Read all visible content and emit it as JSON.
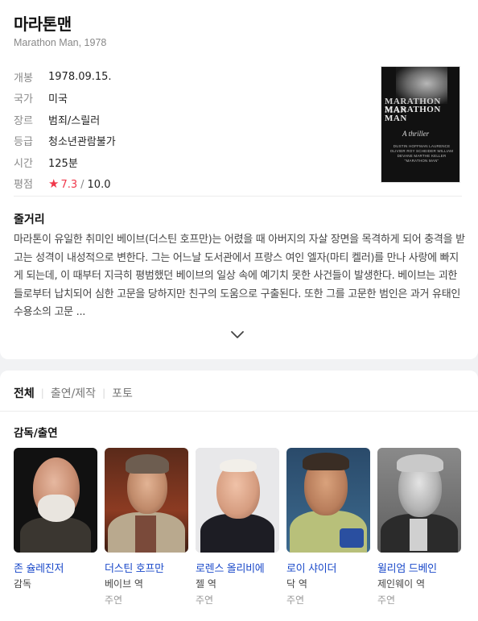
{
  "movie": {
    "title": "마라톤맨",
    "subtitle": "Marathon Man, 1978"
  },
  "facts": [
    {
      "label": "개봉",
      "value": "1978.09.15."
    },
    {
      "label": "국가",
      "value": "미국"
    },
    {
      "label": "장르",
      "value": "범죄/스릴러"
    },
    {
      "label": "등급",
      "value": "청소년관람불가"
    },
    {
      "label": "시간",
      "value": "125분"
    }
  ],
  "rating": {
    "label": "평점",
    "star": "★",
    "score": "7.3",
    "separator": "/",
    "max": "10.0"
  },
  "poster": {
    "title_line1": "MARATHON MAN",
    "title_line2": "MARATHON MAN",
    "tagline": "A thriller",
    "credits": "DUSTIN HOFFMAN LAURENCE OLIVIER ROY SCHEIDER WILLIAM DEVANE MARTHE KELLER \"MARATHON MAN\""
  },
  "synopsis": {
    "title": "줄거리",
    "text": "마라톤이 유일한 취미인 베이브(더스틴 호프만)는 어렸을 때 아버지의 자살 장면을 목격하게 되어 충격을 받고는 성격이 내성적으로 변한다. 그는 어느날 도서관에서 프랑스 여인 엘자(마티 켈러)를 만나 사랑에 빠지게 되는데, 이 때부터 지극히 평범했던 베이브의 일상 속에 예기치 못한 사건들이 발생한다. 베이브는 괴한들로부터 납치되어 심한 고문을 당하지만 친구의 도움으로 구출된다. 또한 그를 고문한 범인은 과거 유태인 수용소의 고문 ..."
  },
  "expand_icon": "chevron-down-icon",
  "tabs": [
    {
      "label": "전체",
      "active": true
    },
    {
      "label": "출연/제작",
      "active": false
    },
    {
      "label": "포토",
      "active": false
    }
  ],
  "cast_section": {
    "title": "감독/출연"
  },
  "cast": [
    {
      "name": "존 슐레진저",
      "role": "감독",
      "type": ""
    },
    {
      "name": "더스틴 호프만",
      "role": "베이브 역",
      "type": "주연"
    },
    {
      "name": "로렌스 올리비에",
      "role": "젤 역",
      "type": "주연"
    },
    {
      "name": "로이 샤이더",
      "role": "닥 역",
      "type": "주연"
    },
    {
      "name": "윌리엄 드베인",
      "role": "제인웨이 역",
      "type": "주연"
    }
  ],
  "colors": {
    "link": "#1a49c9",
    "rating": "#f0374a",
    "label": "#8a8a8a"
  }
}
